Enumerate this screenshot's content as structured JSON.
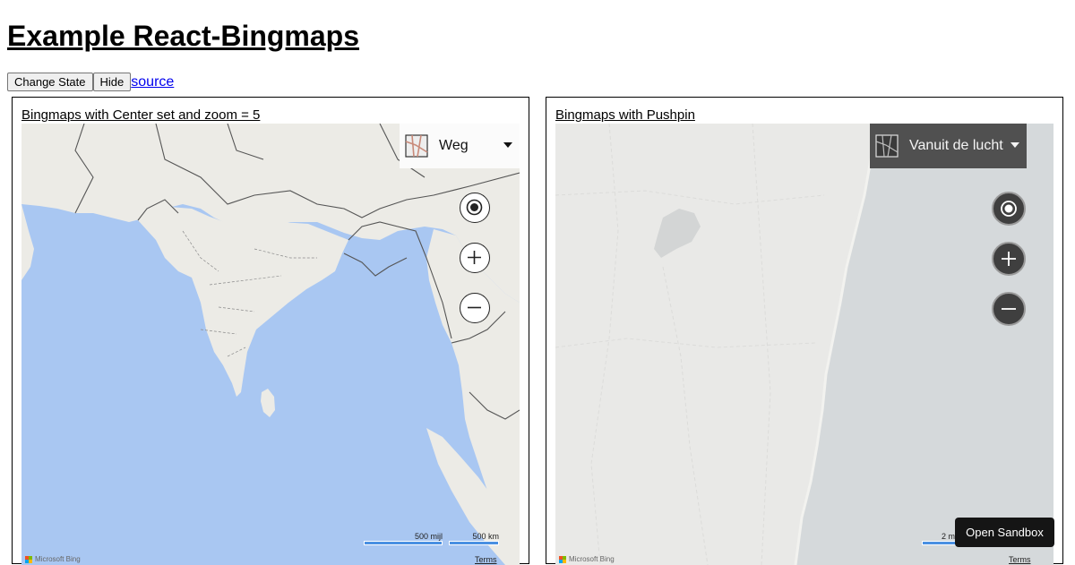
{
  "page": {
    "title": "Example React-Bingmaps"
  },
  "toolbar": {
    "change_state": "Change State",
    "hide": "Hide",
    "source": "source"
  },
  "maps": [
    {
      "title": "Bingmaps with Center set and zoom = 5",
      "map_type": "Weg",
      "scale_miles": "500 mijl",
      "scale_km": "500 km",
      "logo": "Microsoft Bing",
      "terms": "Terms",
      "colors": {
        "water": "#a9c7f2",
        "land": "#ecebe6",
        "border": "#555555"
      }
    },
    {
      "title": "Bingmaps with Pushpin",
      "map_type": "Vanuit de lucht",
      "scale_km": "2 m",
      "logo": "Microsoft Bing",
      "terms": "Terms",
      "colors": {
        "water": "#d5d9db",
        "land": "#e9e9e7"
      }
    }
  ],
  "sandbox": {
    "label": "Open Sandbox"
  }
}
